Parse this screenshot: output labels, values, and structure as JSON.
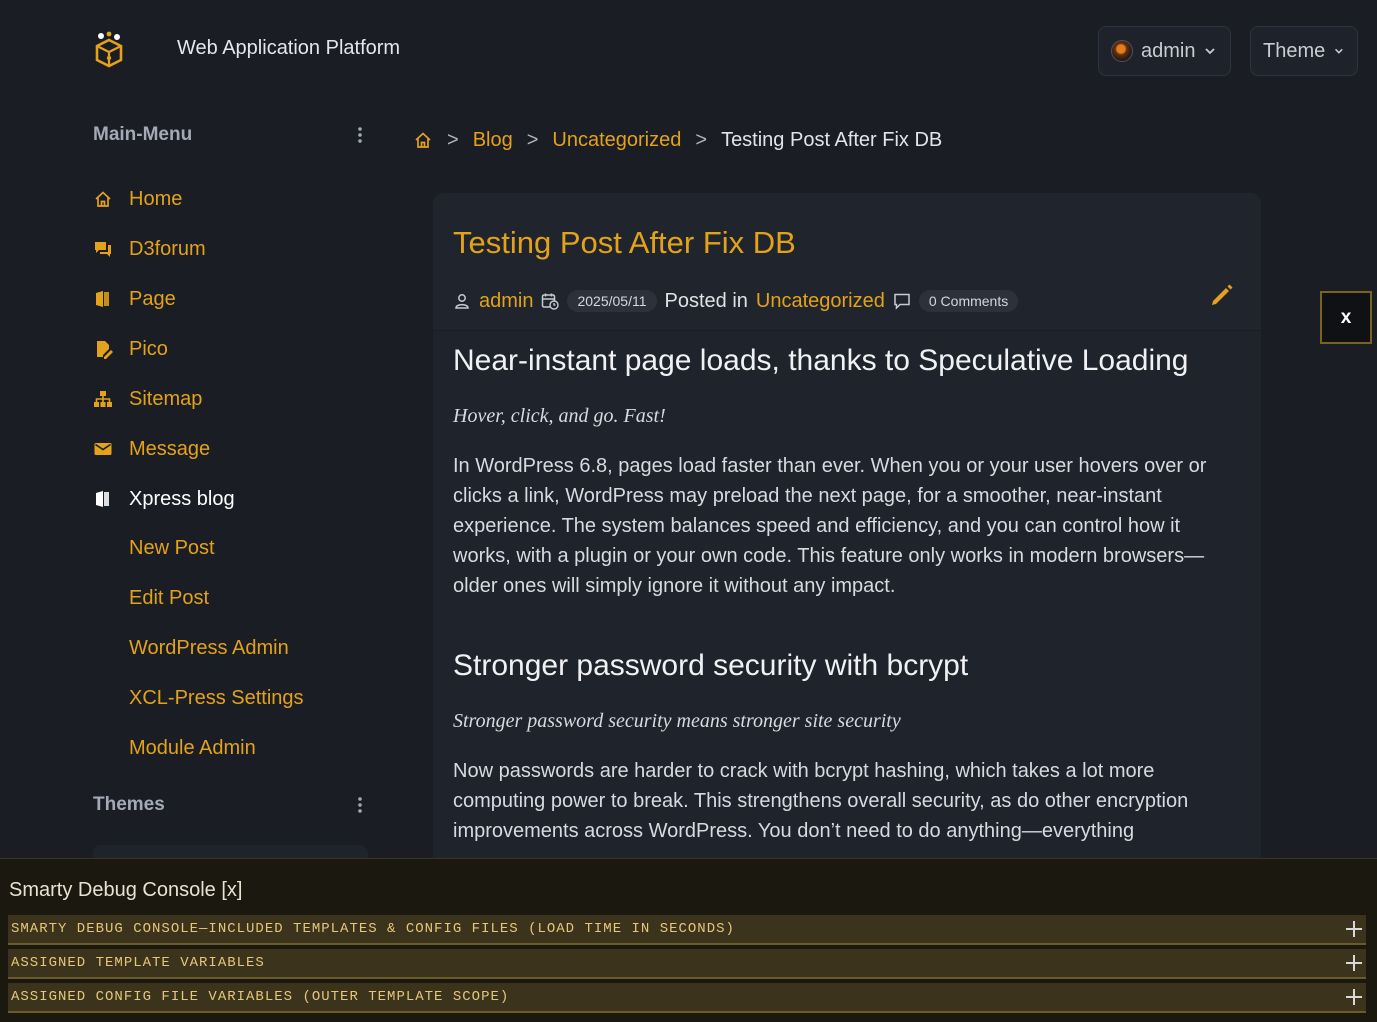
{
  "header": {
    "title": "Web Application Platform",
    "user_label": "admin",
    "theme_label": "Theme"
  },
  "sidebar": {
    "main_menu_label": "Main-Menu",
    "themes_label": "Themes",
    "items": [
      {
        "label": "Home",
        "icon": "home-icon"
      },
      {
        "label": "D3forum",
        "icon": "forum-icon"
      },
      {
        "label": "Page",
        "icon": "book-icon"
      },
      {
        "label": "Pico",
        "icon": "edit-document-icon"
      },
      {
        "label": "Sitemap",
        "icon": "sitemap-icon"
      },
      {
        "label": "Message",
        "icon": "mail-icon"
      },
      {
        "label": "Xpress blog",
        "icon": "book-icon"
      }
    ],
    "sub_items": [
      {
        "label": "New Post"
      },
      {
        "label": "Edit Post"
      },
      {
        "label": "WordPress Admin"
      },
      {
        "label": "XCL-Press Settings"
      },
      {
        "label": "Module Admin"
      }
    ]
  },
  "breadcrumb": {
    "items": [
      "Blog",
      "Uncategorized"
    ],
    "current": "Testing Post After Fix DB",
    "separator": ">"
  },
  "post": {
    "title": "Testing Post After Fix DB",
    "author": "admin",
    "date": "2025/05/11",
    "posted_in_label": "Posted in",
    "category": "Uncategorized",
    "comments": "0 Comments",
    "sections": [
      {
        "heading": "Near-instant page loads, thanks to Speculative Loading",
        "tagline": "Hover, click, and go. Fast!",
        "text": "In WordPress 6.8, pages load faster than ever. When you or your user hovers over or clicks a link, WordPress may preload the next page, for a smoother, near-instant experience. The system balances speed and efficiency, and you can control how it works, with a plugin or your own code. This feature only works in modern browsers—older ones will simply ignore it without any impact."
      },
      {
        "heading": "Stronger password security with bcrypt",
        "tagline": "Stronger password security means stronger site security",
        "text": "Now passwords are harder to crack with bcrypt hashing, which takes a lot more computing power to break. This strengthens overall security, as do other encryption improvements across WordPress. You don’t need to do anything—everything"
      }
    ]
  },
  "close_box": {
    "label": "x"
  },
  "debug_console": {
    "title": "Smarty Debug Console [x]",
    "rows": [
      {
        "label": "SMARTY DEBUG CONSOLE—INCLUDED TEMPLATES & CONFIG FILES (LOAD TIME IN SECONDS)"
      },
      {
        "label": "ASSIGNED TEMPLATE VARIABLES"
      },
      {
        "label": "ASSIGNED CONFIG FILE VARIABLES (OUTER TEMPLATE SCOPE)"
      }
    ]
  },
  "colors": {
    "accent": "#e3a21a",
    "background": "#1a1d24",
    "card": "#1f232b",
    "debug_row": "#3c331c"
  }
}
